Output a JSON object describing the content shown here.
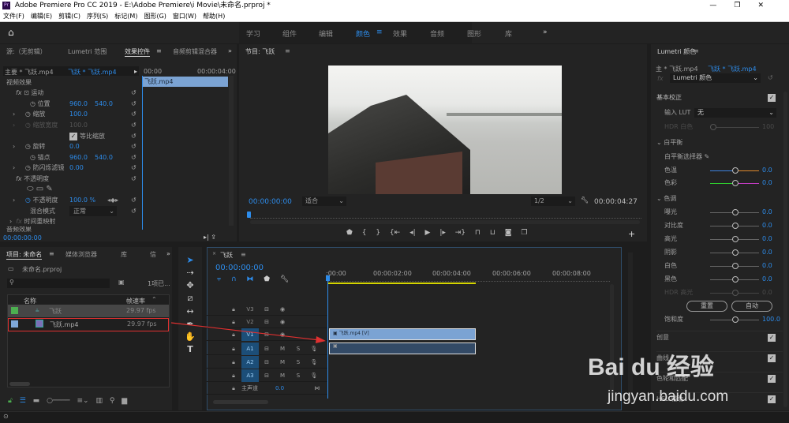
{
  "window": {
    "title": "Adobe Premiere Pro CC 2019 - E:\\Adobe Premiere\\i Movie\\未命名.prproj *",
    "controls": [
      "—",
      "❐",
      "✕"
    ]
  },
  "menu": [
    "文件(F)",
    "编辑(E)",
    "剪辑(C)",
    "序列(S)",
    "标记(M)",
    "图形(G)",
    "窗口(W)",
    "帮助(H)"
  ],
  "workspaces": [
    "学习",
    "组件",
    "编辑",
    "颜色",
    "效果",
    "音频",
    "图形",
    "库"
  ],
  "workspace_active": "颜色",
  "more": "»",
  "effect_controls": {
    "tabs": [
      "源:（无剪辑）",
      "Lumetri 范围",
      "效果控件",
      "音频剪辑混合器"
    ],
    "master_clip": "主要 * 飞跃.mp4",
    "seq_clip": "飞跃 * 飞跃.mp4",
    "time_start": "00:00",
    "time_end": "00:00:04:00",
    "clip_bar": "飞跃.mp4",
    "section_video": "视频效果",
    "section_audio": "音频效果",
    "motion": "运动",
    "position": {
      "label": "位置",
      "x": "960.0",
      "y": "540.0"
    },
    "scale": {
      "label": "缩放",
      "value": "100.0"
    },
    "scale_width": {
      "label": "缩放宽度",
      "value": "100.0"
    },
    "uniform": "等比缩放",
    "rotation": {
      "label": "旋转",
      "value": "0.0"
    },
    "anchor": {
      "label": "锚点",
      "x": "960.0",
      "y": "540.0"
    },
    "flicker": {
      "label": "防闪烁滤镜",
      "value": "0.00"
    },
    "opacity_group": "不透明度",
    "opacity": {
      "label": "不透明度",
      "value": "100.0 %"
    },
    "blend": {
      "label": "混合模式",
      "value": "正常"
    },
    "remap": "时间重映射",
    "timecode": "00:00:00:00"
  },
  "program": {
    "title": "节目: 飞跃",
    "timecode": "00:00:00:00",
    "fit": "适合",
    "resolution": "1/2",
    "duration": "00:00:04:27"
  },
  "project": {
    "tabs": [
      "项目: 未命名",
      "媒体浏览器",
      "库",
      "信"
    ],
    "file": "未命名.prproj",
    "search_placeholder": "",
    "count": "1项已...",
    "col_name": "名称",
    "col_fps": "帧速率",
    "items": [
      {
        "name": "飞跃",
        "fps": "29.97 fps",
        "color": "#4caf50"
      },
      {
        "name": "飞跃.mp4",
        "fps": "29.97 fps",
        "color": "#7fa7d8"
      }
    ]
  },
  "timeline": {
    "title": "飞跃",
    "timecode": "00:00:00:00",
    "ruler": [
      ":00:00",
      "00:00:02:00",
      "00:00:04:00",
      "00:00:06:00",
      "00:00:08:00"
    ],
    "tracks": [
      "V3",
      "V2",
      "V1",
      "A1",
      "A2",
      "A3"
    ],
    "master": "主声道",
    "master_value": "0.0",
    "clip_video": "飞跃.mp4 [V]"
  },
  "lumetri": {
    "title": "Lumetri 颜色",
    "master_clip": "主 * 飞跃.mp4",
    "seq_clip": "飞跃 * 飞跃.mp4",
    "effect": "Lumetri 颜色",
    "basic": "基本校正",
    "lut": {
      "label": "输入 LUT",
      "value": "无"
    },
    "hdr_white": {
      "label": "HDR 白色",
      "value": "100"
    },
    "wb": "白平衡",
    "wb_picker": "白平衡选择器",
    "temp": {
      "label": "色温",
      "value": "0.0"
    },
    "tint": {
      "label": "色彩",
      "value": "0.0"
    },
    "tone": "色调",
    "sliders": [
      {
        "label": "曝光",
        "value": "0.0"
      },
      {
        "label": "对比度",
        "value": "0.0"
      },
      {
        "label": "高光",
        "value": "0.0"
      },
      {
        "label": "阴影",
        "value": "0.0"
      },
      {
        "label": "白色",
        "value": "0.0"
      },
      {
        "label": "黑色",
        "value": "0.0"
      }
    ],
    "hdr_spec": {
      "label": "HDR 高光",
      "value": "0.0"
    },
    "reset": "重置",
    "auto": "自动",
    "saturation": {
      "label": "饱和度",
      "value": "100.0"
    },
    "sections": [
      "创意",
      "曲线",
      "色轮和匹配",
      "HSL 辅助"
    ]
  },
  "watermark": {
    "brand": "Bai du 经验",
    "url": "jingyan.baidu.com"
  }
}
